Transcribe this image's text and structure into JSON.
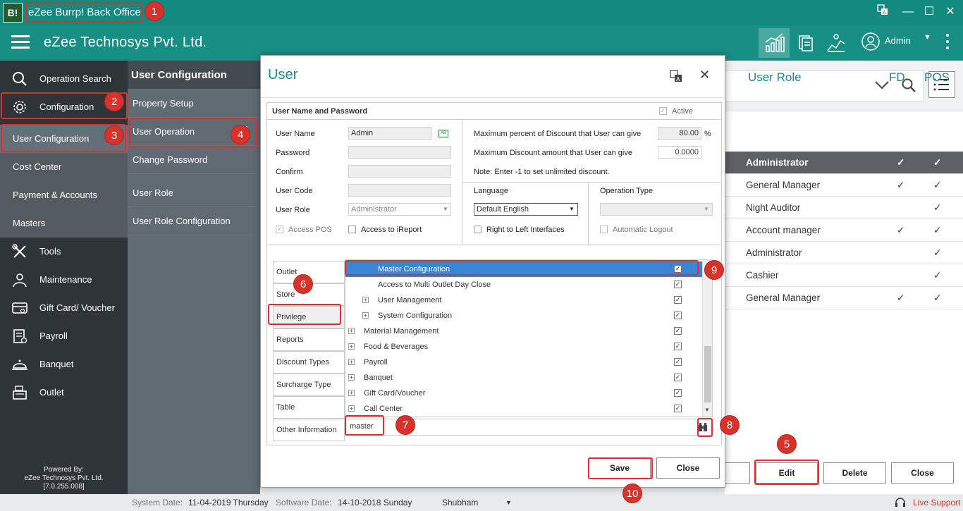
{
  "titlebar": {
    "logo": "B!",
    "title": "eZee Burrp! Back Office"
  },
  "header": {
    "company": "eZee Technosys Pvt. Ltd.",
    "user": "Admin"
  },
  "sidebar": {
    "search": "Operation Search",
    "configuration": "Configuration",
    "subs": [
      "User Configuration",
      "Cost Center",
      "Payment & Accounts",
      "Masters"
    ],
    "items": [
      "Tools",
      "Maintenance",
      "Gift Card/ Voucher",
      "Payroll",
      "Banquet",
      "Outlet"
    ],
    "powered": {
      "line1": "Powered By:",
      "line2": "eZee Technosys Pvt. Ltd.",
      "line3": "[7.0.255.008]"
    }
  },
  "col2": {
    "header": "User Configuration",
    "items": [
      "Property Setup",
      "User Operation",
      "Change Password",
      "User Role",
      "User Role Configuration"
    ]
  },
  "right": {
    "headers": {
      "role": "User Role",
      "fd": "FD",
      "pos": "POS"
    },
    "rows": [
      {
        "name": "Administrator",
        "fd": "✓",
        "pos": "✓"
      },
      {
        "name": "General Manager",
        "fd": "✓",
        "pos": "✓"
      },
      {
        "name": "Night Auditor",
        "fd": "",
        "pos": "✓"
      },
      {
        "name": "Account manager",
        "fd": "✓",
        "pos": "✓"
      },
      {
        "name": "Administrator",
        "fd": "",
        "pos": "✓"
      },
      {
        "name": "Cashier",
        "fd": "",
        "pos": "✓"
      },
      {
        "name": "General Manager",
        "fd": "✓",
        "pos": "✓"
      }
    ],
    "buttons": {
      "edit": "Edit",
      "delete": "Delete",
      "close": "Close"
    }
  },
  "statusbar": {
    "system_date_label": "System Date:",
    "system_date": "11-04-2019 Thursday",
    "software_date_label": "Software Date:",
    "software_date": "14-10-2018 Sunday",
    "user": "Shubham",
    "support": "Live Support"
  },
  "dialog": {
    "title": "User",
    "section_title": "User Name and Password",
    "active_label": "Active",
    "labels": {
      "username": "User Name",
      "password": "Password",
      "confirm": "Confirm",
      "usercode": "User Code",
      "userrole": "User Role"
    },
    "values": {
      "username": "Admin",
      "userrole": "Administrator"
    },
    "access_pos": "Access POS",
    "access_ireport": "Access to iReport",
    "max_percent_label": "Maximum percent of Discount that User can give",
    "max_percent": "80.00",
    "percent_sign": "%",
    "max_amount_label": "Maximum Discount amount that User can give",
    "max_amount": "0.0000",
    "note": "Note: Enter -1 to set unlimited discount.",
    "language_label": "Language",
    "language": "Default English",
    "rtl": "Right to Left Interfaces",
    "optype_label": "Operation Type",
    "auto_logout": "Automatic Logout",
    "tabs": [
      "Outlet",
      "Store",
      "Privilege",
      "Reports",
      "Discount Types",
      "Surcharge Type",
      "Table",
      "Other Information"
    ],
    "tree": [
      {
        "label": "Master Configuration",
        "indent": 2,
        "expander": false,
        "selected": true
      },
      {
        "label": "Access to Multi Outlet Day Close",
        "indent": 2,
        "expander": false
      },
      {
        "label": "User Management",
        "indent": 2,
        "expander": true
      },
      {
        "label": "System Configuration",
        "indent": 2,
        "expander": true
      },
      {
        "label": "Material Management",
        "indent": 1,
        "expander": true
      },
      {
        "label": "Food & Beverages",
        "indent": 1,
        "expander": true
      },
      {
        "label": "Payroll",
        "indent": 1,
        "expander": true
      },
      {
        "label": "Banquet",
        "indent": 1,
        "expander": true
      },
      {
        "label": "Gift Card/Voucher",
        "indent": 1,
        "expander": true
      },
      {
        "label": "Call Center",
        "indent": 1,
        "expander": true
      }
    ],
    "search_value": "master",
    "save": "Save",
    "close": "Close"
  },
  "markers": [
    "1",
    "2",
    "3",
    "4",
    "5",
    "6",
    "7",
    "8",
    "9",
    "10"
  ],
  "colors": {
    "teal": "#178f85",
    "sidebar": "#2f3438",
    "highlight": "#e12d2d",
    "marker": "#d8322b"
  }
}
